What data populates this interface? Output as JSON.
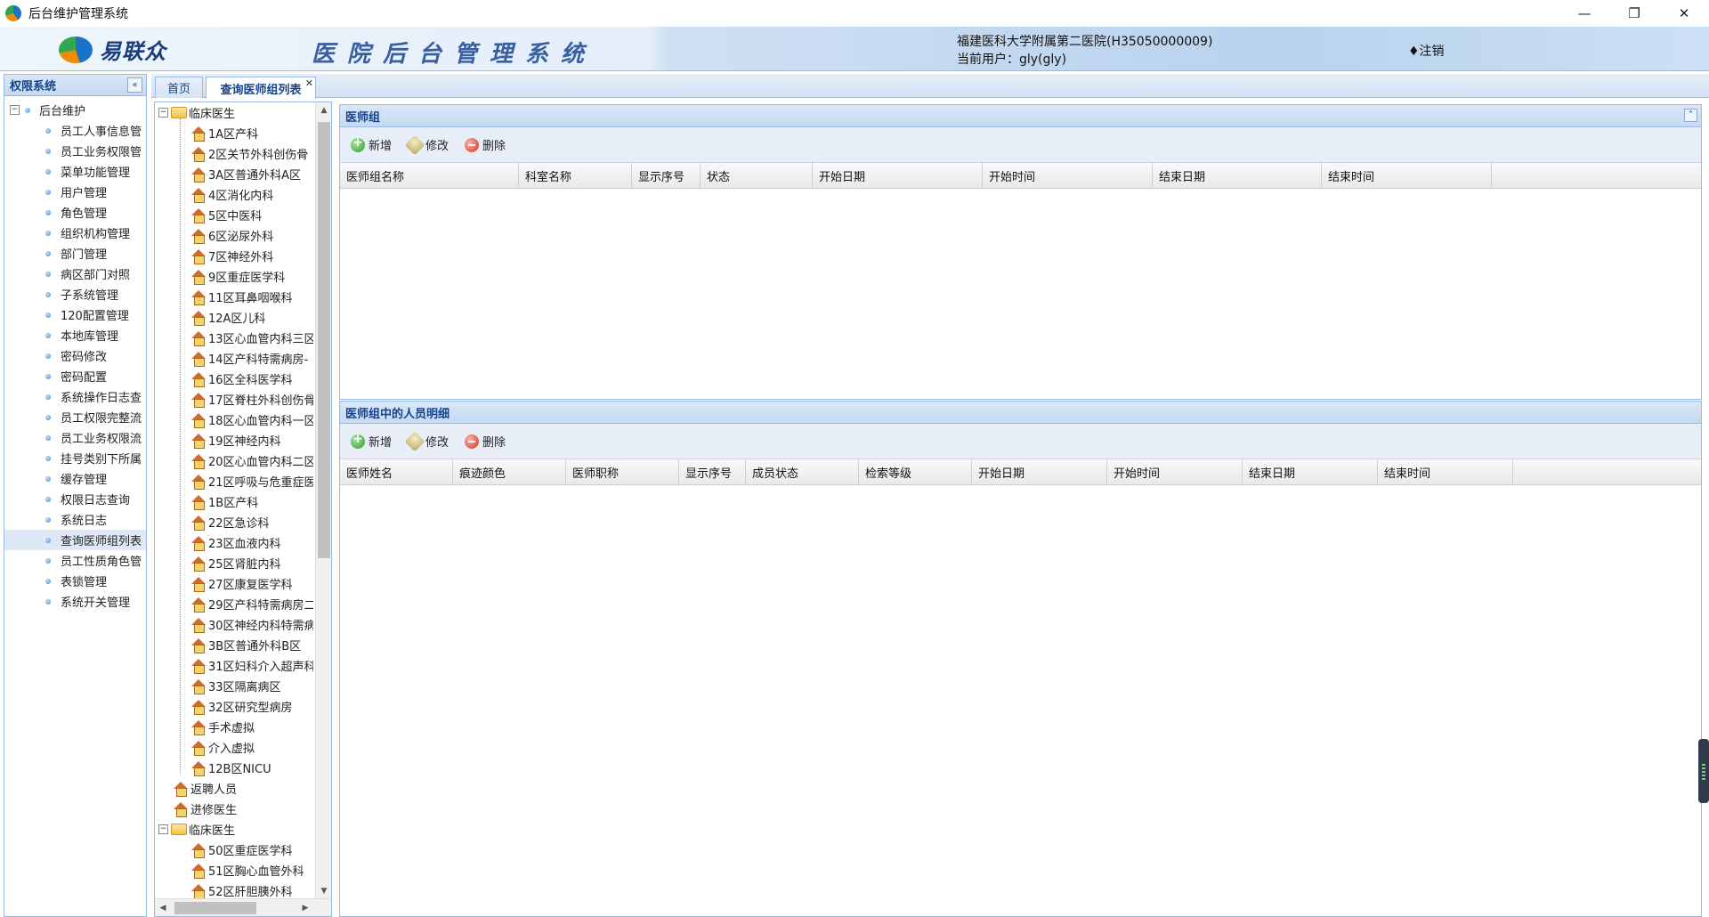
{
  "window": {
    "title": "后台维护管理系统",
    "controls": [
      "—",
      "❐",
      "✕"
    ]
  },
  "header": {
    "logo_text": "易联众",
    "system_title": "医院后台管理系统",
    "hospital": "福建医科大学附属第二医院(H35050000009)",
    "current_user": "当前用户：gly(gly)",
    "logout": "♦注销"
  },
  "sidebar": {
    "title": "权限系统",
    "root": "后台维护",
    "items": [
      "员工人事信息管",
      "员工业务权限管",
      "菜单功能管理",
      "用户管理",
      "角色管理",
      "组织机构管理",
      "部门管理",
      "病区部门对照",
      "子系统管理",
      "120配置管理",
      "本地库管理",
      "密码修改",
      "密码配置",
      "系统操作日志查",
      "员工权限完整流",
      "员工业务权限流",
      "挂号类别下所属",
      "缓存管理",
      "权限日志查询",
      "系统日志",
      "查询医师组列表",
      "员工性质角色管",
      "表锁管理",
      "系统开关管理"
    ],
    "selected_index": 20
  },
  "tabs": [
    {
      "label": "首页"
    },
    {
      "label": "查询医师组列表",
      "close": "✕"
    }
  ],
  "dept_tree": {
    "group1": "临床医生",
    "group1_children": [
      "1A区产科",
      "2区关节外科创伤骨",
      "3A区普通外科A区",
      "4区消化内科",
      "5区中医科",
      "6区泌尿外科",
      "7区神经外科",
      "9区重症医学科",
      "11区耳鼻咽喉科",
      "12A区儿科",
      "13区心血管内科三区",
      "14区产科特需病房-",
      "16区全科医学科",
      "17区脊柱外科创伤骨",
      "18区心血管内科一区",
      "19区神经内科",
      "20区心血管内科二区",
      "21区呼吸与危重症医",
      "1B区产科",
      "22区急诊科",
      "23区血液内科",
      "25区肾脏内科",
      "27区康复医学科",
      "29区产科特需病房二",
      "30区神经内科特需病",
      "3B区普通外科B区",
      "31区妇科介入超声科",
      "33区隔离病区",
      "32区研究型病房",
      "手术虚拟",
      "介入虚拟",
      "12B区NICU"
    ],
    "top_level": [
      "返聘人员",
      "进修医生"
    ],
    "group2": "临床医生",
    "group2_children": [
      "50区重症医学科",
      "51区胸心血管外科",
      "52区肝胆胰外科"
    ]
  },
  "doctor_group": {
    "title": "医师组",
    "toolbar": {
      "add": "新增",
      "edit": "修改",
      "delete": "删除"
    },
    "columns": [
      "医师组名称",
      "科室名称",
      "显示序号",
      "状态",
      "开始日期",
      "开始时间",
      "结束日期",
      "结束时间"
    ]
  },
  "member_detail": {
    "title": "医师组中的人员明细",
    "toolbar": {
      "add": "新增",
      "edit": "修改",
      "delete": "删除"
    },
    "columns": [
      "医师姓名",
      "痕迹颜色",
      "医师职称",
      "显示序号",
      "成员状态",
      "检索等级",
      "开始日期",
      "开始时间",
      "结束日期",
      "结束时间"
    ]
  }
}
